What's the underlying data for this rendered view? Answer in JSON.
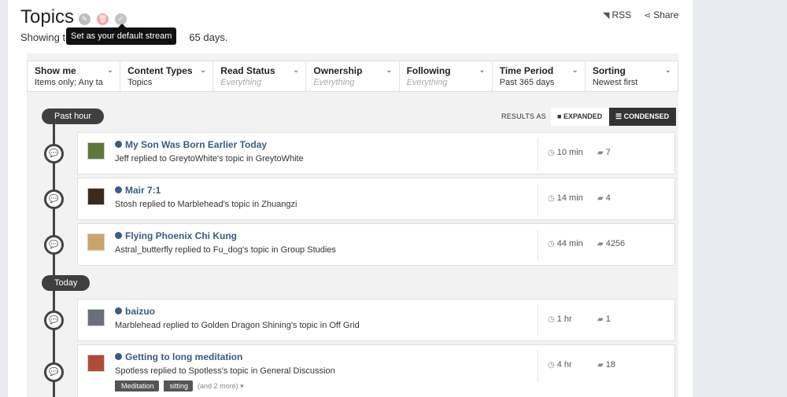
{
  "header": {
    "title": "Topics",
    "subtitle_start": "Showing to",
    "subtitle_end": "65 days.",
    "tooltip": "Set as your default stream",
    "rss": "RSS",
    "share": "Share"
  },
  "filters": [
    {
      "label": "Show me",
      "value": "Items only; Any ta",
      "dim": false
    },
    {
      "label": "Content Types",
      "value": "Topics",
      "dim": false
    },
    {
      "label": "Read Status",
      "value": "Everything",
      "dim": true
    },
    {
      "label": "Ownership",
      "value": "Everything",
      "dim": true
    },
    {
      "label": "Following",
      "value": "Everything",
      "dim": true
    },
    {
      "label": "Time Period",
      "value": "Past 365 days",
      "dim": false
    },
    {
      "label": "Sorting",
      "value": "Newest first",
      "dim": false
    }
  ],
  "results": {
    "label": "RESULTS AS",
    "expanded": "EXPANDED",
    "condensed": "CONDENSED"
  },
  "groups": [
    {
      "label": "Past hour"
    },
    {
      "label": "Today"
    }
  ],
  "items": [
    {
      "title": "My Son Was Born Earlier Today",
      "desc": "Jeff replied to GreytoWhite's topic in GreytoWhite",
      "time": "10 min",
      "replies": "7",
      "avatar_color": "#5b7a3a"
    },
    {
      "title": "Mair 7:1",
      "desc": "Stosh replied to Marblehead's topic in Zhuangzi",
      "time": "14 min",
      "replies": "4",
      "avatar_color": "#3a2a20"
    },
    {
      "title": "Flying Phoenix Chi Kung",
      "desc": "Astral_butterfly replied to Fu_dog's topic in Group Studies",
      "time": "44 min",
      "replies": "4256",
      "avatar_color": "#c9a46a"
    },
    {
      "title": "baizuo",
      "desc": "Marblehead replied to Golden Dragon Shining's topic in Off Grid",
      "time": "1 hr",
      "replies": "1",
      "avatar_color": "#6b6f7a"
    },
    {
      "title": "Getting to long meditation",
      "desc": "Spotless replied to Spotless's topic in General Discussion",
      "time": "4 hr",
      "replies": "18",
      "avatar_color": "#b04a3a",
      "tags": [
        "Meditation",
        "sitting"
      ],
      "more": "(and 2 more)"
    }
  ]
}
